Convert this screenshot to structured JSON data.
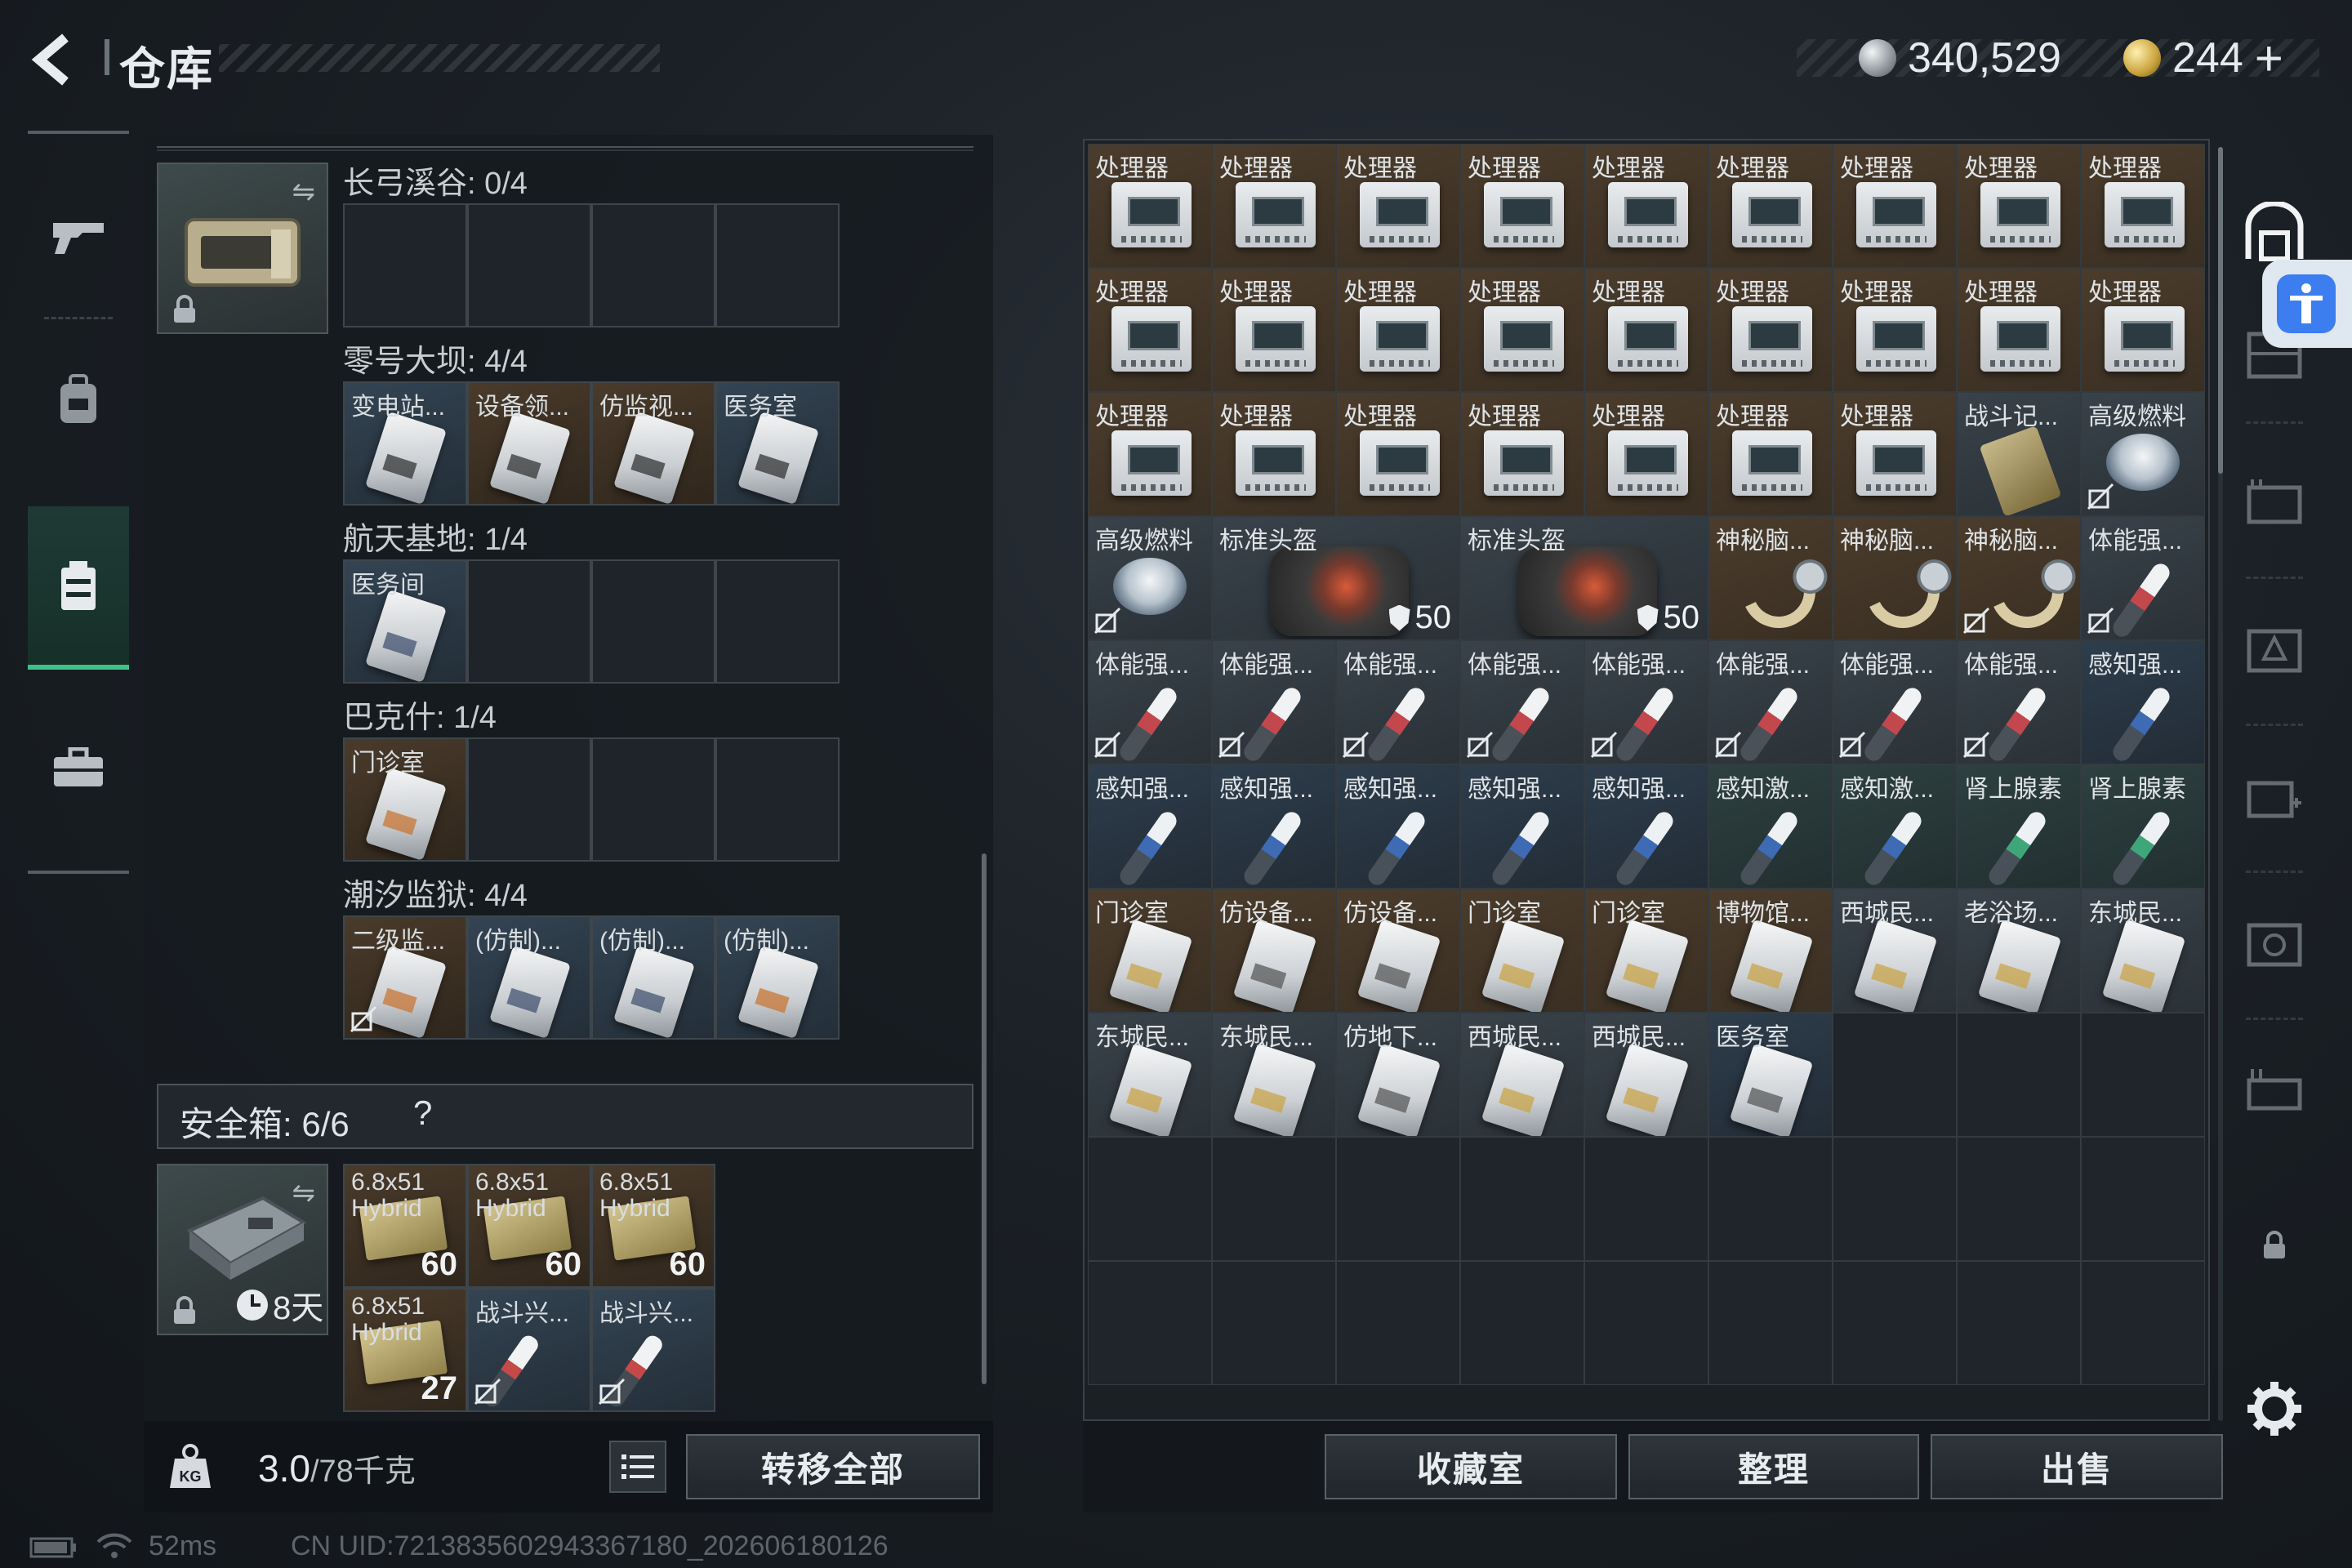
{
  "header": {
    "title": "仓库",
    "silver_amount": "340,529",
    "gold_amount": "244",
    "plus_label": "+"
  },
  "left_nav": {
    "items": [
      {
        "name": "weapon-tab",
        "icon": "gun-icon"
      },
      {
        "name": "backpack-tab",
        "icon": "backpack-icon"
      },
      {
        "name": "storage-tab",
        "icon": "case-icon",
        "active": true
      },
      {
        "name": "toolbox-tab",
        "icon": "briefcase-icon"
      }
    ]
  },
  "keycard_case": {
    "sections": [
      {
        "label": "长弓溪谷: 0/4",
        "slots": [
          "",
          "",
          "",
          ""
        ]
      },
      {
        "label": "零号大坝: 4/4",
        "slots": [
          "变电站...",
          "设备领...",
          "仿监视...",
          "医务室"
        ]
      },
      {
        "label": "航天基地: 1/4",
        "slots": [
          "医务间",
          "",
          "",
          ""
        ]
      },
      {
        "label": "巴克什: 1/4",
        "slots": [
          "门诊室",
          "",
          "",
          ""
        ]
      },
      {
        "label": "潮汐监狱: 4/4",
        "slots": [
          "二级监...",
          "(仿制)...",
          "(仿制)...",
          "(仿制)..."
        ]
      }
    ]
  },
  "safebox": {
    "label": "安全箱:",
    "capacity": "6/6",
    "help": "?",
    "timer": "8天",
    "items": [
      {
        "name": "6.8x51",
        "sub": "Hybrid",
        "count": "60"
      },
      {
        "name": "6.8x51",
        "sub": "Hybrid",
        "count": "60"
      },
      {
        "name": "6.8x51",
        "sub": "Hybrid",
        "count": "60"
      },
      {
        "name": "6.8x51",
        "sub": "Hybrid",
        "count": "27"
      },
      {
        "name": "战斗兴...",
        "sub": "",
        "count": ""
      },
      {
        "name": "战斗兴...",
        "sub": "",
        "count": ""
      }
    ]
  },
  "weight": {
    "current": "3.0",
    "max": "/78千克"
  },
  "buttons": {
    "transfer_all": "转移全部",
    "collection": "收藏室",
    "sort": "整理",
    "sell": "出售"
  },
  "storage": {
    "rows": [
      [
        "处理器",
        "处理器",
        "处理器",
        "处理器",
        "处理器",
        "处理器",
        "处理器",
        "处理器",
        "处理器"
      ],
      [
        "处理器",
        "处理器",
        "处理器",
        "处理器",
        "处理器",
        "处理器",
        "处理器",
        "处理器",
        "处理器"
      ],
      [
        "处理器",
        "处理器",
        "处理器",
        "处理器",
        "处理器",
        "处理器",
        "处理器",
        "战斗记...",
        "高级燃料"
      ],
      [
        "高级燃料",
        "标准头盔",
        "标准头盔",
        "神秘脑...",
        "神秘脑...",
        "神秘脑...",
        "体能强..."
      ],
      [
        "体能强...",
        "体能强...",
        "体能强...",
        "体能强...",
        "体能强...",
        "体能强...",
        "体能强...",
        "体能强...",
        "感知强..."
      ],
      [
        "感知强...",
        "感知强...",
        "感知强...",
        "感知强...",
        "感知强...",
        "感知激...",
        "感知激...",
        "肾上腺素",
        "肾上腺素"
      ],
      [
        "门诊室",
        "仿设备...",
        "仿设备...",
        "门诊室",
        "门诊室",
        "博物馆...",
        "西城民...",
        "老浴场...",
        "东城民..."
      ],
      [
        "东城民...",
        "东城民...",
        "仿地下...",
        "西城民...",
        "西城民...",
        "医务室"
      ]
    ],
    "armor_value": "50"
  },
  "status": {
    "ping": "52ms",
    "uid": "CN UID:7213835602943367180_202606180126"
  }
}
